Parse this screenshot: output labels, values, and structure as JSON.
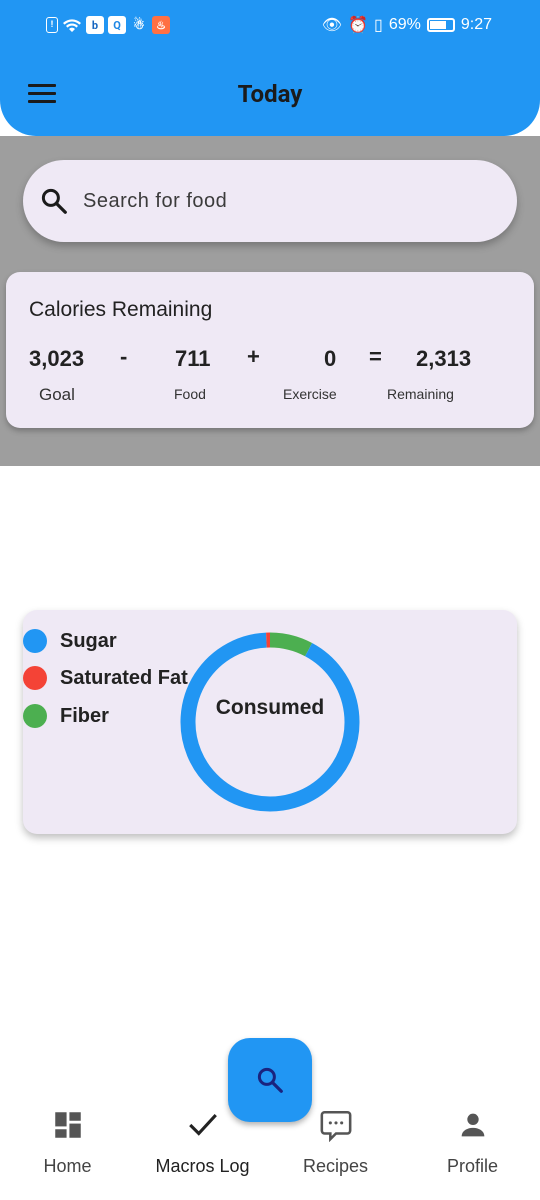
{
  "status_bar": {
    "left_icons": [
      "notification-icon",
      "wifi-icon",
      "b-app-icon",
      "q-app-icon",
      "bot-app-icon",
      "fire-app-icon"
    ],
    "battery_percent": "69%",
    "time": "9:27"
  },
  "header": {
    "title": "Today"
  },
  "search": {
    "placeholder": "Search for food"
  },
  "calories": {
    "title": "Calories Remaining",
    "goal_value": "3,023",
    "minus": "-",
    "food_value": "711",
    "plus": "+",
    "exercise_value": "0",
    "equals": "=",
    "remaining_value": "2,313",
    "goal_label": "Goal",
    "food_label": "Food",
    "exercise_label": "Exercise",
    "remaining_label": "Remaining"
  },
  "macros": {
    "center_label": "Consumed",
    "legend": [
      {
        "label": "Sugar",
        "color": "#2196F3"
      },
      {
        "label": "Saturated Fat",
        "color": "#F44336"
      },
      {
        "label": "Fiber",
        "color": "#4CAF50"
      }
    ]
  },
  "chart_data": {
    "type": "pie",
    "title": "Consumed",
    "series": [
      {
        "name": "Sugar",
        "value": 91.5,
        "color": "#2196F3"
      },
      {
        "name": "Saturated Fat",
        "value": 0.7,
        "color": "#F44336"
      },
      {
        "name": "Fiber",
        "value": 7.8,
        "color": "#4CAF50"
      }
    ],
    "legend_position": "top-left"
  },
  "bottom_nav": {
    "items": [
      {
        "label": "Home",
        "icon": "dashboard-icon"
      },
      {
        "label": "Macros Log",
        "icon": "check-icon"
      },
      {
        "label": "Recipes",
        "icon": "chat-icon"
      },
      {
        "label": "Profile",
        "icon": "person-icon"
      }
    ]
  },
  "colors": {
    "primary": "#2196F3",
    "card": "#efe9f5",
    "grey_band": "#9e9e9e"
  }
}
